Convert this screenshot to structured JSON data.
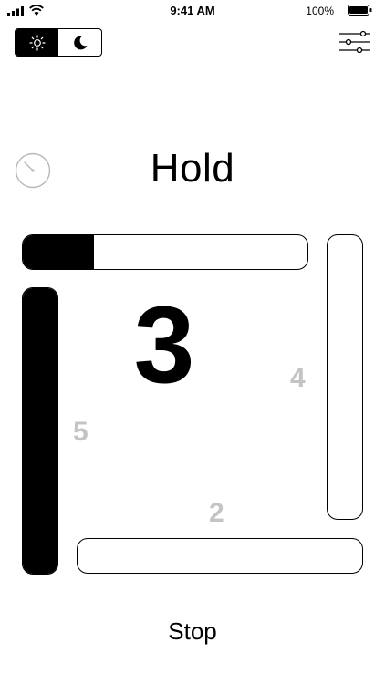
{
  "status_bar": {
    "time": "9:41 AM",
    "battery_percent": "100%"
  },
  "theme_toggle": {
    "selected": "light",
    "options": [
      "light",
      "dark"
    ]
  },
  "exercise": {
    "phase": "Hold",
    "countdown": "3",
    "side_numbers": {
      "right": "4",
      "left": "5",
      "bottom": "2"
    },
    "progress": {
      "top": 0.25,
      "right": 0,
      "left": 1,
      "bottom": 0
    }
  },
  "controls": {
    "stop_label": "Stop"
  },
  "icons": [
    "signal-icon",
    "wifi-icon",
    "battery-icon",
    "sun-icon",
    "moon-icon",
    "settings-sliders-icon",
    "timer-icon"
  ]
}
